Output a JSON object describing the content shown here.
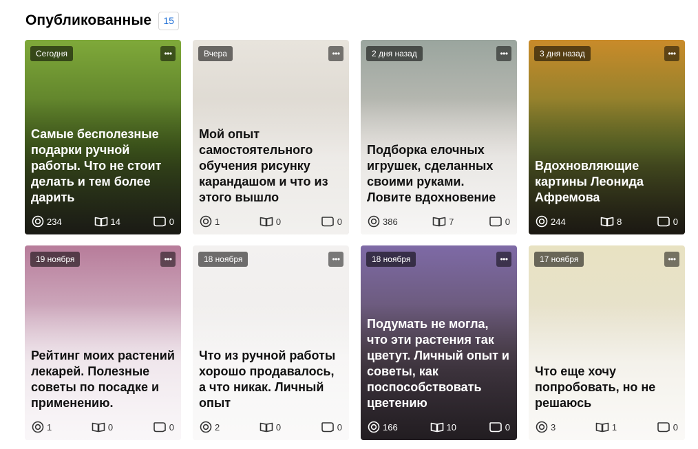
{
  "section": {
    "title": "Опубликованные",
    "count": "15"
  },
  "cards": [
    {
      "date": "Сегодня",
      "title": "Самые бесполезные подарки ручной работы. Что не стоит делать и тем более дарить",
      "views": "234",
      "reads": "14",
      "comments": "0",
      "theme": "dark",
      "colors": [
        "#7fa93a",
        "#4d6b22",
        "#3a3a2e"
      ]
    },
    {
      "date": "Вчера",
      "title": "Мой опыт самостоятельного обучения рисунку карандашом и что из этого вышло",
      "views": "1",
      "reads": "0",
      "comments": "0",
      "theme": "light",
      "colors": [
        "#e8e4dd",
        "#d9d4cc",
        "#cbc6bd"
      ]
    },
    {
      "date": "2 дня назад",
      "title": "Подборка елочных игрушек, сделанных своими руками. Ловите вдохновение",
      "views": "386",
      "reads": "7",
      "comments": "0",
      "theme": "light",
      "colors": [
        "#9aa59e",
        "#c9c4bd",
        "#dedad6"
      ]
    },
    {
      "date": "3 дня назад",
      "title": "Вдохновляющие картины Леонида Афремова",
      "views": "244",
      "reads": "8",
      "comments": "0",
      "theme": "dark",
      "colors": [
        "#c98b2a",
        "#6d7a2e",
        "#3b3428"
      ]
    },
    {
      "date": "19 ноября",
      "title": "Рейтинг моих растений лекарей. Полезные советы по посадке и применению.",
      "views": "1",
      "reads": "0",
      "comments": "0",
      "theme": "light",
      "colors": [
        "#b77c9a",
        "#dcc6d3",
        "#e9dfe6"
      ]
    },
    {
      "date": "18 ноября",
      "title": "Что из ручной работы хорошо продавалось, а что никак. Личный опыт",
      "views": "2",
      "reads": "0",
      "comments": "0",
      "theme": "light",
      "colors": [
        "#f3f1f0",
        "#efedec",
        "#ebe9e8"
      ]
    },
    {
      "date": "18 ноября",
      "title": "Подумать не могла, что эти растения так цветут. Личный опыт и советы, как поспособствовать цветению",
      "views": "166",
      "reads": "10",
      "comments": "0",
      "theme": "dark",
      "colors": [
        "#7e6aa6",
        "#5f5060",
        "#4b4049"
      ]
    },
    {
      "date": "17 ноября",
      "title": "Что еще хочу попробовать, но не решаюсь",
      "views": "3",
      "reads": "1",
      "comments": "0",
      "theme": "light",
      "colors": [
        "#e8e2c2",
        "#e6e1d0",
        "#ebe8df"
      ]
    }
  ]
}
